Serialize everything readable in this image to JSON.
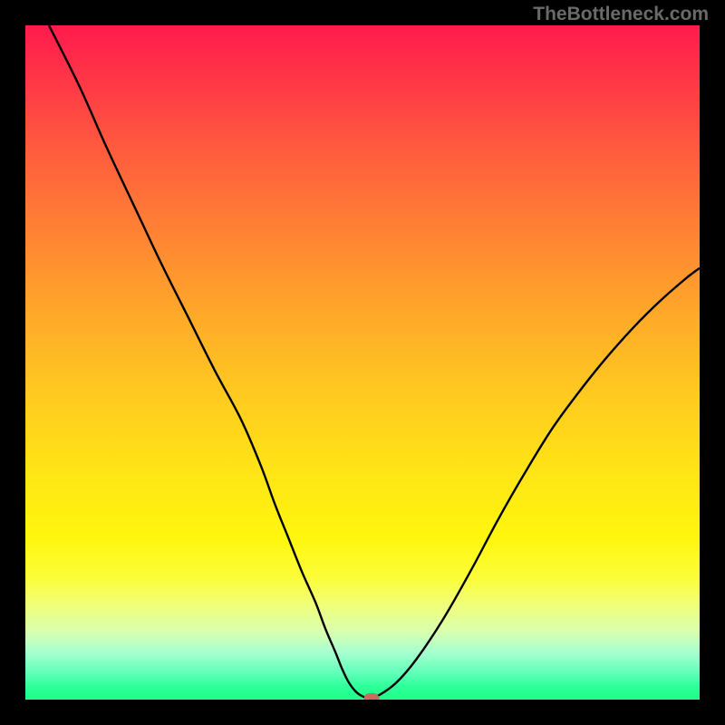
{
  "watermark_text": "TheBottleneck.com",
  "chart_data": {
    "type": "line",
    "title": "",
    "xlabel": "",
    "ylabel": "",
    "x_range": [
      0,
      100
    ],
    "y_range": [
      0,
      100
    ],
    "series": [
      {
        "name": "bottleneck-curve",
        "x": [
          3.5,
          8,
          12,
          16,
          20,
          24,
          28,
          32,
          35,
          37,
          39,
          41,
          43,
          44.5,
          46,
          47,
          48,
          49,
          50,
          51,
          52.5,
          55,
          58,
          62,
          66,
          70,
          74,
          78,
          82,
          86,
          90,
          94,
          98,
          100
        ],
        "y": [
          100,
          91,
          82,
          73.5,
          65,
          57,
          49,
          41.5,
          34.5,
          29,
          24,
          19,
          14.5,
          10.5,
          7,
          4.5,
          2.5,
          1.2,
          0.5,
          0.2,
          0.7,
          2.5,
          6,
          12,
          19,
          26.5,
          33.5,
          40,
          45.5,
          50.5,
          55,
          59,
          62.5,
          64
        ]
      }
    ],
    "marker": {
      "x": 51.3,
      "y": 0.2,
      "color": "#cc6a5d"
    },
    "gradient_stops": [
      {
        "pos": 0,
        "color": "#ff1b4d"
      },
      {
        "pos": 50,
        "color": "#ffc820"
      },
      {
        "pos": 80,
        "color": "#fdfd40"
      },
      {
        "pos": 100,
        "color": "#1eff88"
      }
    ]
  }
}
